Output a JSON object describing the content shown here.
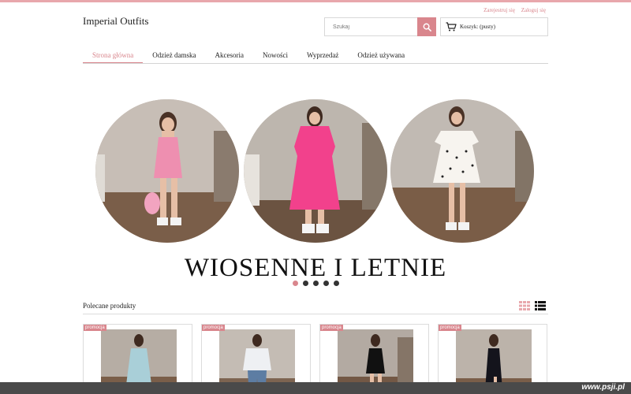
{
  "header": {
    "logo": "Imperial Outfits",
    "register_link": "Zarejestruj się",
    "login_link": "Zaloguj się",
    "search_placeholder": "Szukaj",
    "cart_label": "Koszyk: (pusty)"
  },
  "nav": {
    "items": [
      {
        "label": "Strona główna"
      },
      {
        "label": "Odzież damska"
      },
      {
        "label": "Akcesoria"
      },
      {
        "label": "Nowości"
      },
      {
        "label": "Wyprzedaż"
      },
      {
        "label": "Odzież używana"
      }
    ]
  },
  "hero": {
    "caption": "WIOSENNE I LETNIE",
    "slide_count": 5,
    "active_slide": 1
  },
  "products_section": {
    "title": "Polecane produkty",
    "products": [
      {
        "badge": "promocja"
      },
      {
        "badge": "promocja"
      },
      {
        "badge": "promocja"
      },
      {
        "badge": "promocja"
      }
    ]
  },
  "watermark": "www.psji.pl",
  "colors": {
    "accent": "#d9868d",
    "dress_1": "#ee8fb0",
    "dress_2": "#f2418c",
    "dress_3": "#f7f4ef"
  },
  "icons": [
    "search-icon",
    "cart-icon",
    "grid-view-icon",
    "list-view-icon"
  ]
}
